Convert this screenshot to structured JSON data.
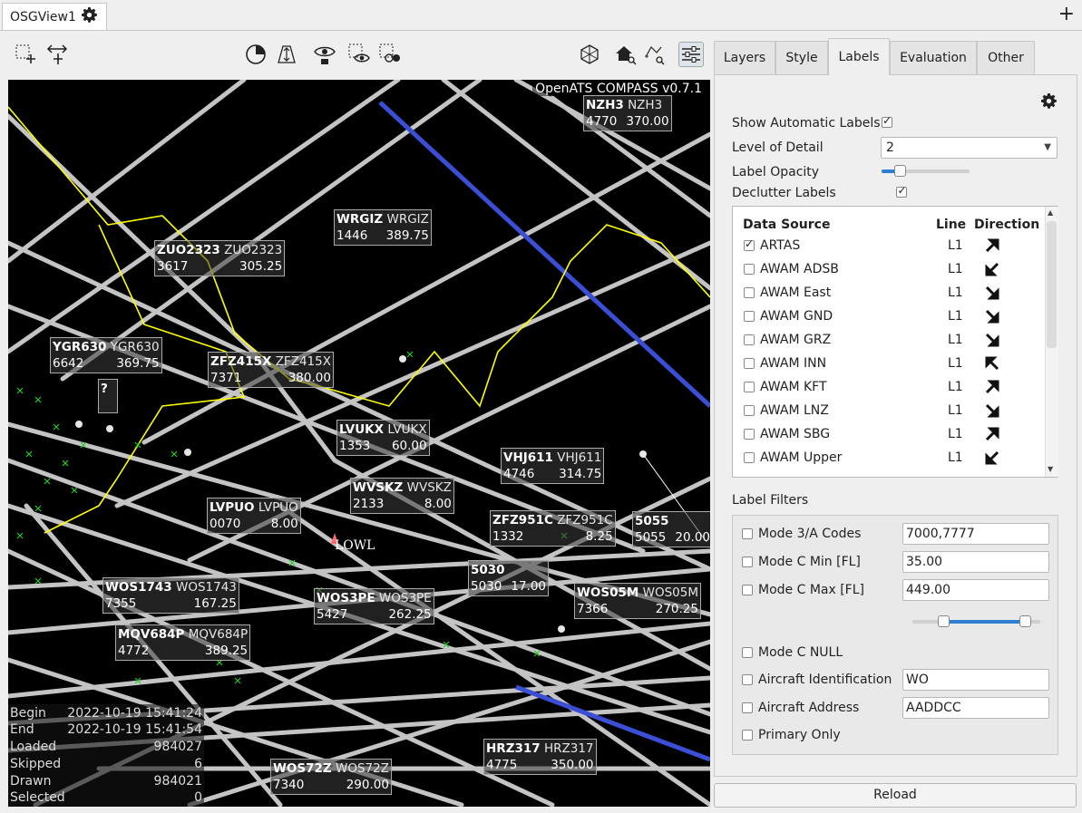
{
  "window_tab": {
    "title": "OSGView1"
  },
  "icons": {
    "tab_settings": "gear-icon",
    "new_tab": "plus-icon",
    "toolbar": [
      "select-rect-add-icon",
      "select-rect-move-icon",
      "time-clock-icon",
      "altitude-filter-icon",
      "eye-hand-icon",
      "view-select-icon",
      "view-select-dots-icon",
      "3d-rotate-icon",
      "home-zoom-icon",
      "zoom-selection-icon",
      "settings-sliders-icon"
    ],
    "panel_settings": "gear-icon"
  },
  "map": {
    "version": "OpenATS COMPASS v0.7.1",
    "marker": "LOWL",
    "labels": [
      {
        "callsign": "NZH3",
        "sub": "NZH3",
        "code": "4770",
        "fl": "370.00"
      },
      {
        "callsign": "WRGIZ",
        "sub": "WRGIZ",
        "code": "1446",
        "fl": "389.75"
      },
      {
        "callsign": "ZUO2323",
        "sub": "ZUO2323",
        "code": "3617",
        "fl": "305.25"
      },
      {
        "callsign": "YGR630",
        "sub": "YGR630",
        "code": "6642",
        "fl": "369.75"
      },
      {
        "callsign": "ZFZ415X",
        "sub": "ZFZ415X",
        "code": "7371",
        "fl": "380.00"
      },
      {
        "callsign": "?",
        "sub": "",
        "code": "",
        "fl": ""
      },
      {
        "callsign": "LVUKX",
        "sub": "LVUKX",
        "code": "1353",
        "fl": "60.00"
      },
      {
        "callsign": "VHJ611",
        "sub": "VHJ611",
        "code": "4746",
        "fl": "314.75"
      },
      {
        "callsign": "WVSKZ",
        "sub": "WVSKZ",
        "code": "2133",
        "fl": "8.00"
      },
      {
        "callsign": "LVPUO",
        "sub": "LVPUO",
        "code": "0070",
        "fl": "8.00"
      },
      {
        "callsign": "ZFZ951C",
        "sub": "ZFZ951C",
        "code": "1332",
        "fl": "8.25"
      },
      {
        "callsign": "5055",
        "sub": "",
        "code": "5055",
        "fl": "20.00"
      },
      {
        "callsign": "5030",
        "sub": "",
        "code": "5030",
        "fl": "17.00"
      },
      {
        "callsign": "WOS1743",
        "sub": "WOS1743",
        "code": "7355",
        "fl": "167.25"
      },
      {
        "callsign": "WOS3PE",
        "sub": "WOS3PE",
        "code": "5427",
        "fl": "262.25"
      },
      {
        "callsign": "WOS05M",
        "sub": "WOS05M",
        "code": "7366",
        "fl": "270.25"
      },
      {
        "callsign": "MQV684P",
        "sub": "MQV684P",
        "code": "4772",
        "fl": "389.25"
      },
      {
        "callsign": "HRZ317",
        "sub": "HRZ317",
        "code": "4775",
        "fl": "350.00"
      },
      {
        "callsign": "WOS72Z",
        "sub": "WOS72Z",
        "code": "7340",
        "fl": "290.00"
      }
    ],
    "stats": [
      {
        "k": "Begin",
        "v": "2022-10-19 15:41:24"
      },
      {
        "k": "End",
        "v": "2022-10-19 15:41:54"
      },
      {
        "k": "Loaded",
        "v": "984027"
      },
      {
        "k": "Skipped",
        "v": "6"
      },
      {
        "k": "Drawn",
        "v": "984021"
      },
      {
        "k": "Selected",
        "v": "0"
      }
    ]
  },
  "panel": {
    "tabs": [
      "Layers",
      "Style",
      "Labels",
      "Evaluation",
      "Other"
    ],
    "active_tab": "Labels",
    "show_auto_labels": {
      "label": "Show Automatic Labels",
      "checked": true
    },
    "level_of_detail": {
      "label": "Level of Detail",
      "value": "2"
    },
    "label_opacity": {
      "label": "Label Opacity",
      "value": 0.25
    },
    "declutter": {
      "label": "Declutter Labels",
      "checked": true
    },
    "ds_headers": {
      "source": "Data Source",
      "line": "Line",
      "direction": "Direction"
    },
    "data_sources": [
      {
        "name": "ARTAS",
        "checked": true,
        "line": "L1",
        "dir": "up-right"
      },
      {
        "name": "AWAM ADSB",
        "checked": false,
        "line": "L1",
        "dir": "down-left"
      },
      {
        "name": "AWAM East",
        "checked": false,
        "line": "L1",
        "dir": "down-right"
      },
      {
        "name": "AWAM GND",
        "checked": false,
        "line": "L1",
        "dir": "down-right"
      },
      {
        "name": "AWAM GRZ",
        "checked": false,
        "line": "L1",
        "dir": "down-right"
      },
      {
        "name": "AWAM INN",
        "checked": false,
        "line": "L1",
        "dir": "up-left"
      },
      {
        "name": "AWAM KFT",
        "checked": false,
        "line": "L1",
        "dir": "up-right"
      },
      {
        "name": "AWAM LNZ",
        "checked": false,
        "line": "L1",
        "dir": "down-right"
      },
      {
        "name": "AWAM SBG",
        "checked": false,
        "line": "L1",
        "dir": "up-right"
      },
      {
        "name": "AWAM Upper",
        "checked": false,
        "line": "L1",
        "dir": "down-left"
      }
    ],
    "filters_title": "Label Filters",
    "filters": [
      {
        "label": "Mode 3/A Codes",
        "checked": false,
        "value": "7000,7777"
      },
      {
        "label": "Mode C Min [FL]",
        "checked": false,
        "value": "35.00"
      },
      {
        "label": "Mode C Max [FL]",
        "checked": false,
        "value": "449.00"
      },
      {
        "label": "Mode C NULL",
        "checked": false
      },
      {
        "label": "Aircraft Identification",
        "checked": false,
        "value": "WO"
      },
      {
        "label": "Aircraft Address",
        "checked": false,
        "value": "AADDCC"
      },
      {
        "label": "Primary Only",
        "checked": false
      }
    ],
    "range_slider": {
      "min": 0.25,
      "max": 0.92
    },
    "reload": "Reload"
  },
  "colors": {
    "accent": "#2f7fd0",
    "track": "#cfcfcf",
    "boundary": "#ffff00",
    "cross": "#22cc22",
    "blue_track": "#3a4fd6"
  }
}
